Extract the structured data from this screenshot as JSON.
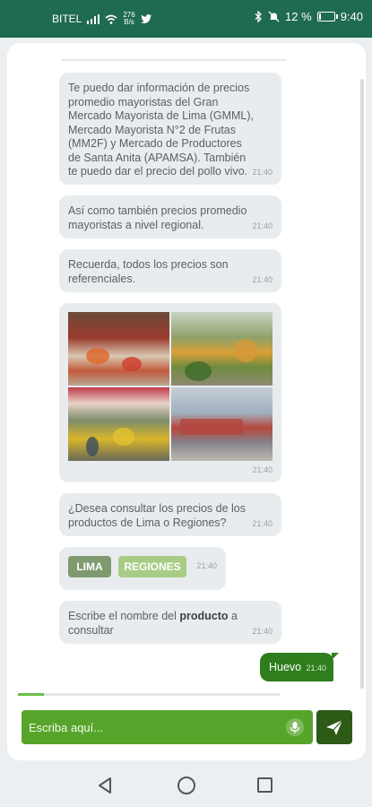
{
  "status_bar": {
    "carrier": "BITEL",
    "net_speed_value": "276",
    "net_speed_unit": "B/s",
    "battery": "12 %",
    "battery_level": 0.12,
    "time": "9:40",
    "icons": [
      "signal-icon",
      "wifi-icon",
      "twitter-icon",
      "bluetooth-icon",
      "mute-icon",
      "battery-icon"
    ]
  },
  "messages": [
    {
      "text": "Te puedo dar información de precios promedio mayoristas del Gran Mercado Mayorista de Lima (GMML), Mercado Mayorista N°2 de Frutas (MM2F) y Mercado de Productores de Santa Anita (APAMSA). También te puedo dar el precio del pollo vivo.",
      "time": "21:40"
    },
    {
      "text": "Así como también precios promedio mayoristas a nivel regional.",
      "time": "21:40"
    },
    {
      "text": "Recuerda, todos los precios son referenciales.",
      "time": "21:40"
    },
    {
      "image": "market-photos-collage",
      "time": "21:40"
    },
    {
      "text": "¿Desea consultar los precios de los productos de Lima o Regiones?",
      "time": "21:40"
    },
    {
      "options": [
        "LIMA",
        "REGIONES"
      ],
      "time": "21:40"
    },
    {
      "text_before": "Escribe el nombre del ",
      "text_bold": "producto",
      "text_after": " a consultar",
      "time": "21:40"
    }
  ],
  "outgoing": {
    "text": "Huevo",
    "time": "21:40"
  },
  "progress": 0.1,
  "composer": {
    "placeholder": "Escriba aquí..."
  },
  "colors": {
    "status_bar": "#1f6b4f",
    "composer": "#57a42a",
    "send_button": "#2e5a18",
    "outgoing_bubble": "#2f7d1c",
    "incoming_bubble": "#e9ecef"
  }
}
